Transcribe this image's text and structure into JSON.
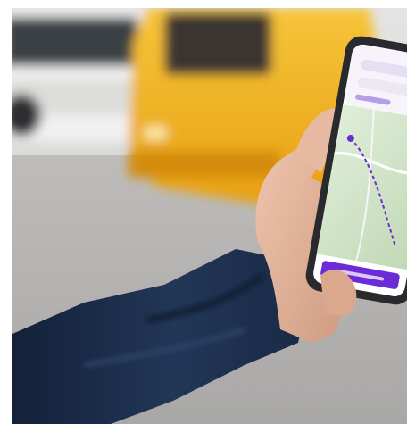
{
  "photo": {
    "subject": "hand-holding-phone",
    "colors": {
      "road": "#b7b5b3",
      "sky": "#dcdcdb",
      "bus_yellow": "#f2b21b",
      "sleeve_navy": "#1d2e4a",
      "skin": "#e2b39b",
      "map_green": "#cfe2c4",
      "app_purple": "#6b2bd6"
    }
  },
  "phone_screen": {
    "app": "map-journey-planner",
    "button_label": ""
  }
}
